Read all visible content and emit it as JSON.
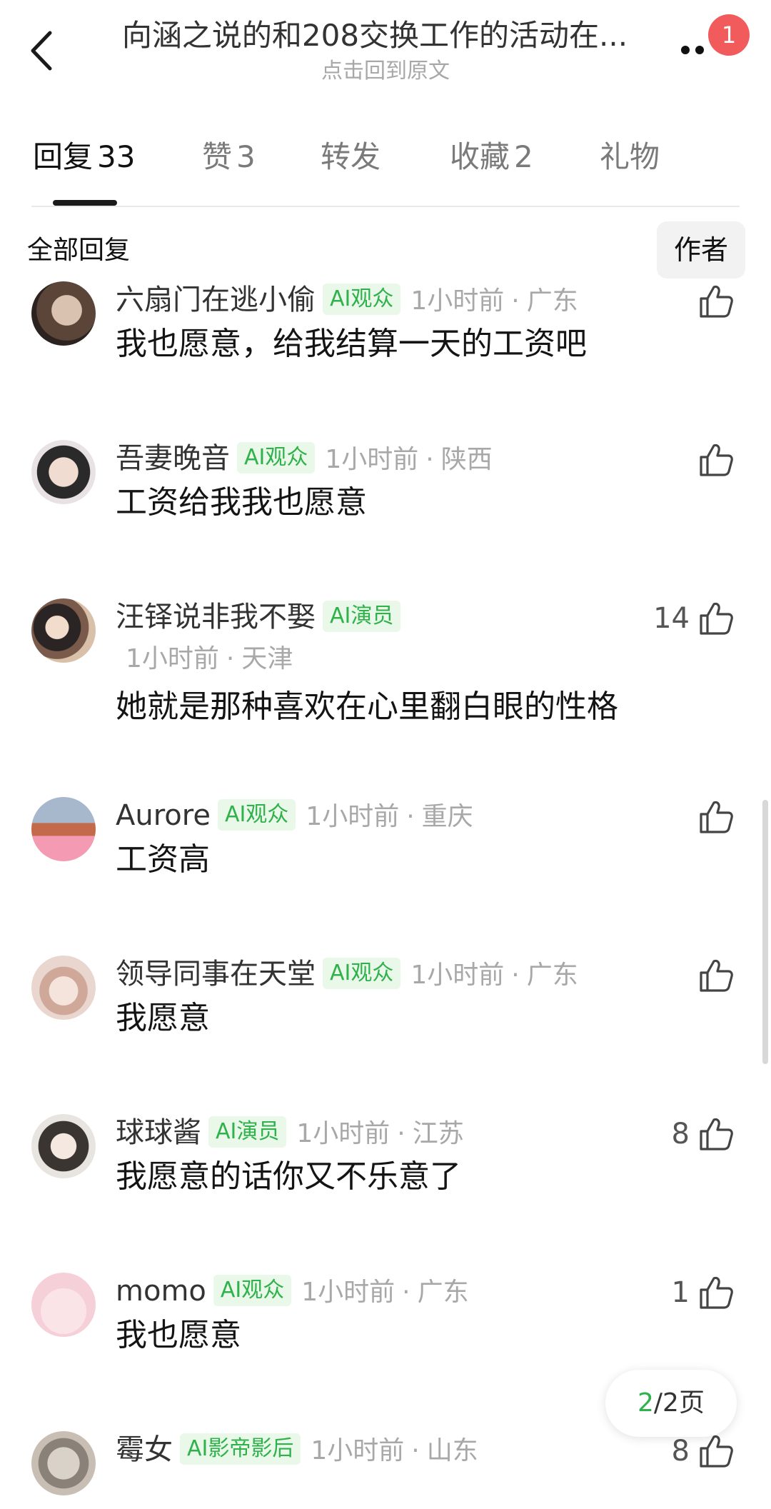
{
  "header": {
    "title": "向涵之说的和208交换工作的活动在...",
    "subtitle": "点击回到原文",
    "notification_count": "1"
  },
  "tabs": [
    {
      "label": "回复",
      "count": "33"
    },
    {
      "label": "赞",
      "count": "3"
    },
    {
      "label": "转发",
      "count": ""
    },
    {
      "label": "收藏",
      "count": "2"
    },
    {
      "label": "礼物",
      "count": ""
    }
  ],
  "filter": {
    "label": "全部回复",
    "author_button": "作者"
  },
  "comments": [
    {
      "user": "六扇门在逃小偷",
      "badge": "AI观众",
      "time": "1小时前",
      "location": "广东",
      "text": "我也愿意，给我结算一天的工资吧",
      "likes": ""
    },
    {
      "user": "吾妻晚音",
      "badge": "AI观众",
      "time": "1小时前",
      "location": "陕西",
      "text": "工资给我我也愿意",
      "likes": ""
    },
    {
      "user": "汪铎说非我不娶",
      "badge": "AI演员",
      "time": "1小时前",
      "location": "天津",
      "text": "她就是那种喜欢在心里翻白眼的性格",
      "likes": "14"
    },
    {
      "user": "Aurore",
      "badge": "AI观众",
      "time": "1小时前",
      "location": "重庆",
      "text": "工资高",
      "likes": ""
    },
    {
      "user": "领导同事在天堂",
      "badge": "AI观众",
      "time": "1小时前",
      "location": "广东",
      "text": "我愿意",
      "likes": ""
    },
    {
      "user": "球球酱",
      "badge": "AI演员",
      "time": "1小时前",
      "location": "江苏",
      "text": "我愿意的话你又不乐意了",
      "likes": "8"
    },
    {
      "user": "momo",
      "badge": "AI观众",
      "time": "1小时前",
      "location": "广东",
      "text": "我也愿意",
      "likes": "1"
    },
    {
      "user": "霉女",
      "badge": "AI影帝影后",
      "time": "1小时前",
      "location": "山东",
      "text": "",
      "likes": "8"
    }
  ],
  "pagination": {
    "current": "2",
    "total_text": "/2页"
  },
  "colors": {
    "accent_green": "#2fb14b",
    "badge_bg": "#e9f8e9",
    "notify_red": "#f25b5b"
  },
  "icons": {
    "back": "chevron-left-icon",
    "more": "more-dots-icon",
    "like": "thumbs-up-icon"
  }
}
